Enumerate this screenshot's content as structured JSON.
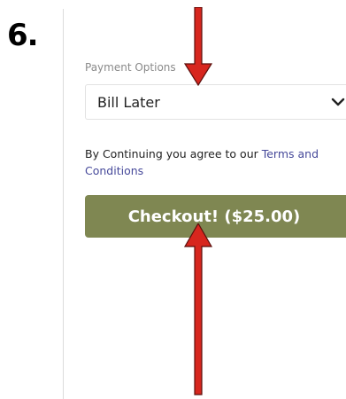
{
  "step": {
    "number": "6."
  },
  "payment": {
    "label": "Payment Options",
    "selected": "Bill Later"
  },
  "terms": {
    "prefix": "By Continuing you agree to our ",
    "link_text": "Terms and Conditions"
  },
  "checkout": {
    "label": "Checkout! ($25.00)"
  },
  "colors": {
    "button": "#7f8752",
    "link": "#46499a",
    "arrow_fill": "#d7261e",
    "arrow_stroke": "#5a0f0c"
  },
  "icons": {
    "dropdown": "chevron-down-icon",
    "annotation": "arrow-icon"
  }
}
